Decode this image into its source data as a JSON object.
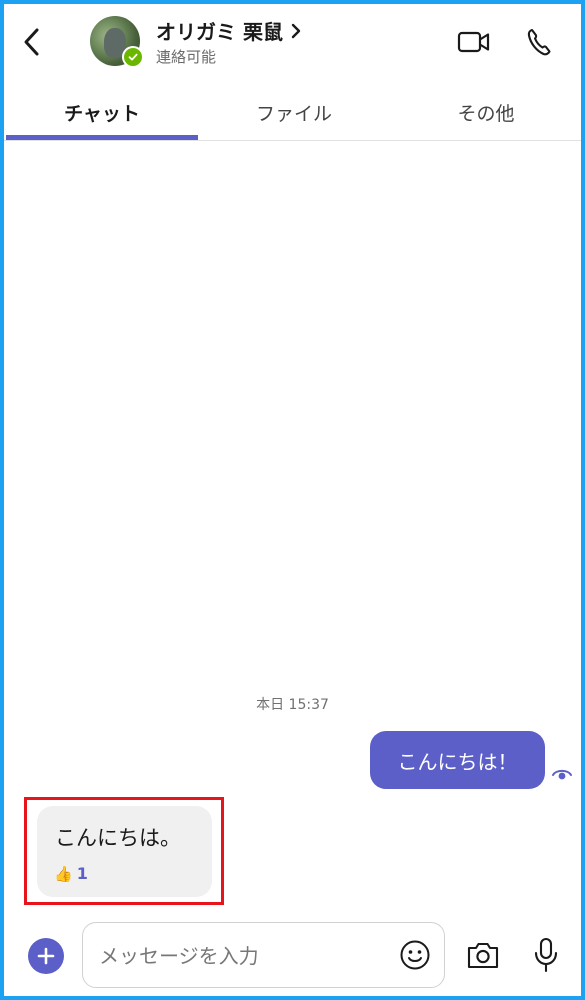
{
  "header": {
    "contact_name": "オリガミ 栗鼠",
    "contact_status": "連絡可能",
    "icons": {
      "back": "chevron-left-icon",
      "video": "video-camera-icon",
      "call": "phone-icon",
      "status": "check-icon"
    },
    "status_color": "#6bb700"
  },
  "tabs": [
    {
      "label": "チャット",
      "active": true
    },
    {
      "label": "ファイル",
      "active": false
    },
    {
      "label": "その他",
      "active": false
    }
  ],
  "chat": {
    "timestamp": "本日 15:37",
    "messages": [
      {
        "direction": "outgoing",
        "text": "こんにちは！",
        "status_icon": "seen-eye-icon"
      },
      {
        "direction": "incoming",
        "text": "こんにちは。",
        "reaction": {
          "icon": "👍",
          "count": "1"
        }
      }
    ]
  },
  "composer": {
    "placeholder": "メッセージを入力",
    "icons": {
      "add": "plus-icon",
      "emoji": "emoji-icon",
      "camera": "camera-icon",
      "mic": "microphone-icon"
    }
  },
  "colors": {
    "accent": "#5b5fc7",
    "frame_border": "#1da1f2",
    "highlight": "#e8141c"
  }
}
